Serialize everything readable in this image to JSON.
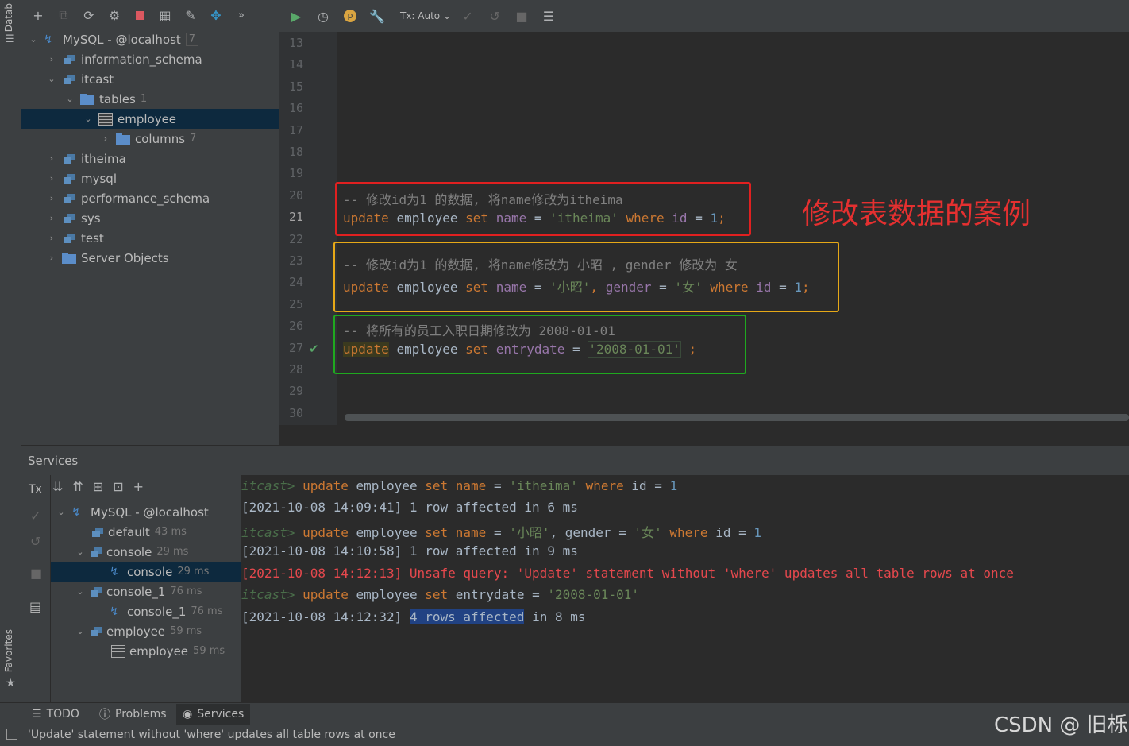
{
  "left_strip": {
    "database_label": "Datab",
    "favorites_label": "Favorites"
  },
  "db_tree": {
    "root": {
      "label": "MySQL - @localhost",
      "count": "7"
    },
    "items": [
      {
        "label": "information_schema"
      },
      {
        "label": "itcast"
      },
      {
        "label": "tables",
        "count": "1"
      },
      {
        "label": "employee"
      },
      {
        "label": "columns",
        "count": "7"
      },
      {
        "label": "itheima"
      },
      {
        "label": "mysql"
      },
      {
        "label": "performance_schema"
      },
      {
        "label": "sys"
      },
      {
        "label": "test"
      },
      {
        "label": "Server Objects"
      }
    ]
  },
  "editor_toolbar": {
    "tx_mode": "Tx: Auto"
  },
  "editor": {
    "line_numbers": [
      "13",
      "14",
      "15",
      "16",
      "17",
      "18",
      "19",
      "20",
      "21",
      "22",
      "23",
      "24",
      "25",
      "26",
      "27",
      "28",
      "29",
      "30"
    ],
    "comment1": "-- 修改id为1 的数据, 将name修改为itheima",
    "comment2": "-- 修改id为1 的数据, 将name修改为 小昭 , gender 修改为 女",
    "comment3": "-- 将所有的员工入职日期修改为 2008-01-01",
    "annotation": "修改表数据的案例",
    "tokens": {
      "update": "update",
      "employee": "employee",
      "set": "set",
      "name": "name",
      "eq": "=",
      "itheima": "'itheima'",
      "where": "where",
      "id": "id",
      "one": "1",
      "semi": ";",
      "xiaozhao": "'小昭'",
      "comma": ",",
      "gender": "gender",
      "nv": "'女'",
      "entrydate": "entrydate",
      "date": "'2008-01-01'",
      "spsemi": " ;"
    }
  },
  "services": {
    "title": "Services",
    "tx_label": "Tx",
    "tree": [
      {
        "label": "MySQL - @localhost",
        "time": ""
      },
      {
        "label": "default",
        "time": "43 ms"
      },
      {
        "label": "console",
        "time": "29 ms"
      },
      {
        "label": "console",
        "time": "29 ms"
      },
      {
        "label": "console_1",
        "time": "76 ms"
      },
      {
        "label": "console_1",
        "time": "76 ms"
      },
      {
        "label": "employee",
        "time": "59 ms"
      },
      {
        "label": "employee",
        "time": "59 ms"
      }
    ],
    "console": {
      "prompt": "itcast>",
      "cmd1_a": "update",
      "cmd1_b": "employee",
      "cmd1_c": "set",
      "cmd1_d": "name",
      "cmd1_e": "=",
      "cmd1_f": "'itheima'",
      "cmd1_g": "where",
      "cmd1_h": "id",
      "cmd1_i": "=",
      "cmd1_j": "1",
      "res1": "[2021-10-08 14:09:41] 1 row affected in 6 ms",
      "cmd2_a": "update",
      "cmd2_b": "employee",
      "cmd2_c": "set",
      "cmd2_d": "name",
      "cmd2_e": "=",
      "cmd2_f": "'小昭'",
      "cmd2_g": ", gender =",
      "cmd2_h": "'女'",
      "cmd2_i": "where",
      "cmd2_j": "id =",
      "cmd2_k": "1",
      "res2": "[2021-10-08 14:10:58] 1 row affected in 9 ms",
      "warn": "[2021-10-08 14:12:13] Unsafe query: 'Update' statement without 'where' updates all table rows at once",
      "cmd3_a": "update",
      "cmd3_b": "employee",
      "cmd3_c": "set",
      "cmd3_d": "entrydate =",
      "cmd3_e": "'2008-01-01'",
      "res3_a": "[2021-10-08 14:12:32]",
      "res3_b": "4 rows affected",
      "res3_c": "in 8 ms"
    }
  },
  "bottom_tabs": {
    "todo": "TODO",
    "problems": "Problems",
    "services": "Services"
  },
  "status": {
    "message": "'Update' statement without 'where' updates all table rows at once",
    "watermark": "CSDN @ 旧栎"
  },
  "colors": {
    "comment_box1": "#e02020",
    "comment_box2": "#e6a817",
    "comment_box3": "#1fa81f",
    "annotation": "#e53030"
  }
}
